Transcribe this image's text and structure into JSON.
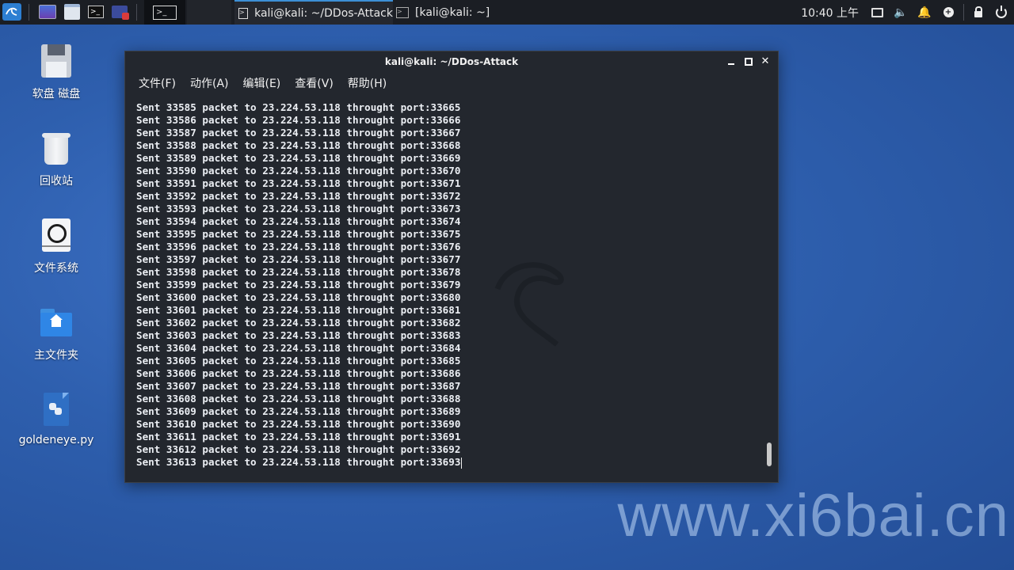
{
  "panel": {
    "task_terminal_active": "kali@kali: ~/DDos-Attack",
    "task_terminal_2": "[kali@kali: ~]",
    "clock": "10:40 上午",
    "launcher_icons": [
      "kali-menu-icon",
      "desktop-icon",
      "file-manager-icon",
      "terminal-icon",
      "screen-recorder-icon",
      "terminal-workspace-icon"
    ],
    "tray_icons": [
      "display-icon",
      "volume-icon",
      "notification-bell-icon",
      "update-icon",
      "lock-icon",
      "power-icon"
    ]
  },
  "desktop": {
    "icons": [
      {
        "label": "软盘 磁盘",
        "icon": "floppy-icon"
      },
      {
        "label": "回收站",
        "icon": "trash-icon"
      },
      {
        "label": "文件系统",
        "icon": "filesystem-icon"
      },
      {
        "label": "主文件夹",
        "icon": "home-folder-icon"
      },
      {
        "label": "goldeneye.py",
        "icon": "python-file-icon"
      }
    ]
  },
  "window": {
    "title": "kali@kali: ~/DDos-Attack",
    "menu": [
      "文件(F)",
      "动作(A)",
      "编辑(E)",
      "查看(V)",
      "帮助(H)"
    ],
    "lines": [
      "Sent 33585 packet to 23.224.53.118 throught port:33665",
      "Sent 33586 packet to 23.224.53.118 throught port:33666",
      "Sent 33587 packet to 23.224.53.118 throught port:33667",
      "Sent 33588 packet to 23.224.53.118 throught port:33668",
      "Sent 33589 packet to 23.224.53.118 throught port:33669",
      "Sent 33590 packet to 23.224.53.118 throught port:33670",
      "Sent 33591 packet to 23.224.53.118 throught port:33671",
      "Sent 33592 packet to 23.224.53.118 throught port:33672",
      "Sent 33593 packet to 23.224.53.118 throught port:33673",
      "Sent 33594 packet to 23.224.53.118 throught port:33674",
      "Sent 33595 packet to 23.224.53.118 throught port:33675",
      "Sent 33596 packet to 23.224.53.118 throught port:33676",
      "Sent 33597 packet to 23.224.53.118 throught port:33677",
      "Sent 33598 packet to 23.224.53.118 throught port:33678",
      "Sent 33599 packet to 23.224.53.118 throught port:33679",
      "Sent 33600 packet to 23.224.53.118 throught port:33680",
      "Sent 33601 packet to 23.224.53.118 throught port:33681",
      "Sent 33602 packet to 23.224.53.118 throught port:33682",
      "Sent 33603 packet to 23.224.53.118 throught port:33683",
      "Sent 33604 packet to 23.224.53.118 throught port:33684",
      "Sent 33605 packet to 23.224.53.118 throught port:33685",
      "Sent 33606 packet to 23.224.53.118 throught port:33686",
      "Sent 33607 packet to 23.224.53.118 throught port:33687",
      "Sent 33608 packet to 23.224.53.118 throught port:33688",
      "Sent 33609 packet to 23.224.53.118 throught port:33689",
      "Sent 33610 packet to 23.224.53.118 throught port:33690",
      "Sent 33611 packet to 23.224.53.118 throught port:33691",
      "Sent 33612 packet to 23.224.53.118 throught port:33692",
      "Sent 33613 packet to 23.224.53.118 throught port:33693"
    ],
    "scroll_position": 1.0
  },
  "watermark": "www.xi6bai.cn",
  "colors": {
    "desktop_bg": "#2e5fae",
    "panel_bg": "#1b1e24",
    "terminal_bg": "#23272e",
    "terminal_fg": "#eceff4",
    "accent": "#3d8fd6"
  }
}
